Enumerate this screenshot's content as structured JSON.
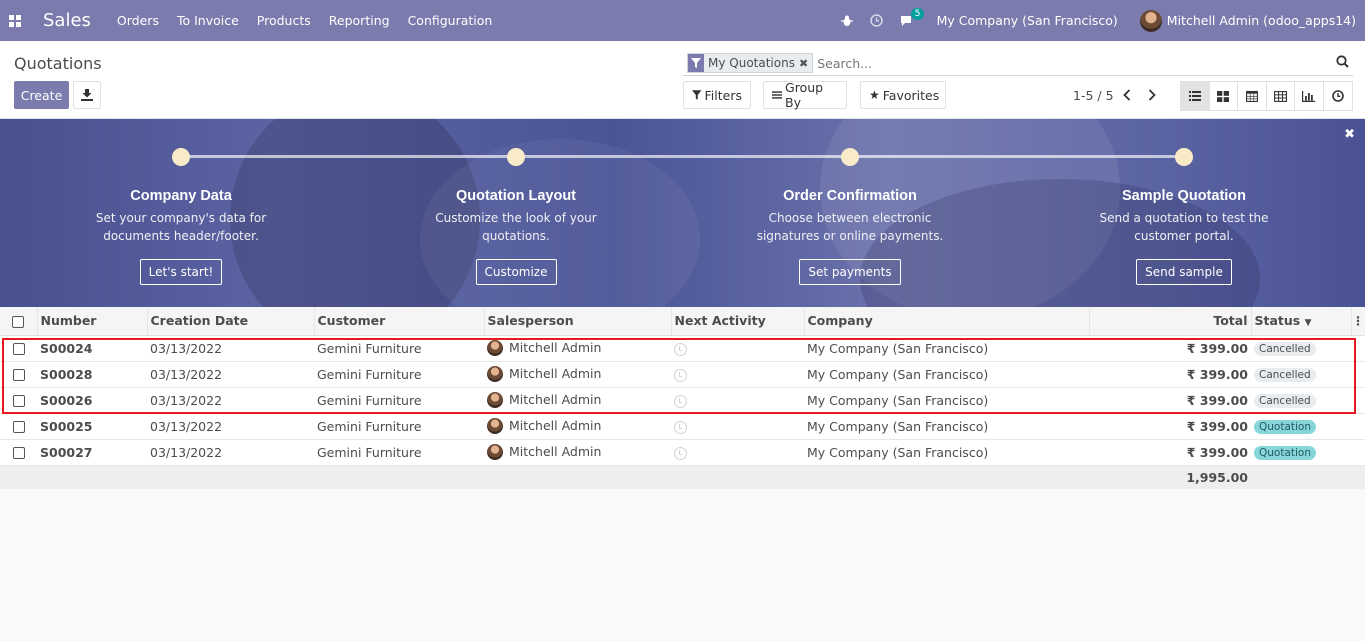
{
  "navbar": {
    "app_name": "Sales",
    "menu": [
      "Orders",
      "To Invoice",
      "Products",
      "Reporting",
      "Configuration"
    ],
    "chat_count": "5",
    "company": "My Company (San Francisco)",
    "user": "Mitchell Admin (odoo_apps14)"
  },
  "control_panel": {
    "breadcrumb": "Quotations",
    "create_label": "Create",
    "facet_label": "My Quotations",
    "search_placeholder": "Search...",
    "filters_label": "Filters",
    "groupby_label": "Group By",
    "favorites_label": "Favorites",
    "pager": "1-5 / 5"
  },
  "onboarding": {
    "steps": [
      {
        "title": "Company Data",
        "desc1": "Set your company's data for",
        "desc2": "documents header/footer.",
        "button": "Let's start!"
      },
      {
        "title": "Quotation Layout",
        "desc1": "Customize the look of your",
        "desc2": "quotations.",
        "button": "Customize"
      },
      {
        "title": "Order Confirmation",
        "desc1": "Choose between electronic",
        "desc2": "signatures or online payments.",
        "button": "Set payments"
      },
      {
        "title": "Sample Quotation",
        "desc1": "Send a quotation to test the",
        "desc2": "customer portal.",
        "button": "Send sample"
      }
    ]
  },
  "table": {
    "columns": [
      "Number",
      "Creation Date",
      "Customer",
      "Salesperson",
      "Next Activity",
      "Company",
      "Total",
      "Status"
    ],
    "rows": [
      {
        "number": "S00024",
        "date": "03/13/2022",
        "customer": "Gemini Furniture",
        "salesperson": "Mitchell Admin",
        "company": "My Company (San Francisco)",
        "total": "₹ 399.00",
        "status": "Cancelled"
      },
      {
        "number": "S00028",
        "date": "03/13/2022",
        "customer": "Gemini Furniture",
        "salesperson": "Mitchell Admin",
        "company": "My Company (San Francisco)",
        "total": "₹ 399.00",
        "status": "Cancelled"
      },
      {
        "number": "S00026",
        "date": "03/13/2022",
        "customer": "Gemini Furniture",
        "salesperson": "Mitchell Admin",
        "company": "My Company (San Francisco)",
        "total": "₹ 399.00",
        "status": "Cancelled"
      },
      {
        "number": "S00025",
        "date": "03/13/2022",
        "customer": "Gemini Furniture",
        "salesperson": "Mitchell Admin",
        "company": "My Company (San Francisco)",
        "total": "₹ 399.00",
        "status": "Quotation"
      },
      {
        "number": "S00027",
        "date": "03/13/2022",
        "customer": "Gemini Furniture",
        "salesperson": "Mitchell Admin",
        "company": "My Company (San Francisco)",
        "total": "₹ 399.00",
        "status": "Quotation"
      }
    ],
    "sum_total": "1,995.00"
  },
  "colors": {
    "brand": "#7c7bad",
    "highlight": "#e5191f",
    "quotation_pill": "#87d6da"
  },
  "icons": [
    "apps-icon",
    "bug-icon",
    "clock-icon",
    "chat-icon",
    "download-icon",
    "filter-icon",
    "search-icon",
    "list-view-icon",
    "kanban-view-icon",
    "calendar-view-icon",
    "pivot-view-icon",
    "graph-view-icon",
    "activity-view-icon",
    "close-icon"
  ]
}
